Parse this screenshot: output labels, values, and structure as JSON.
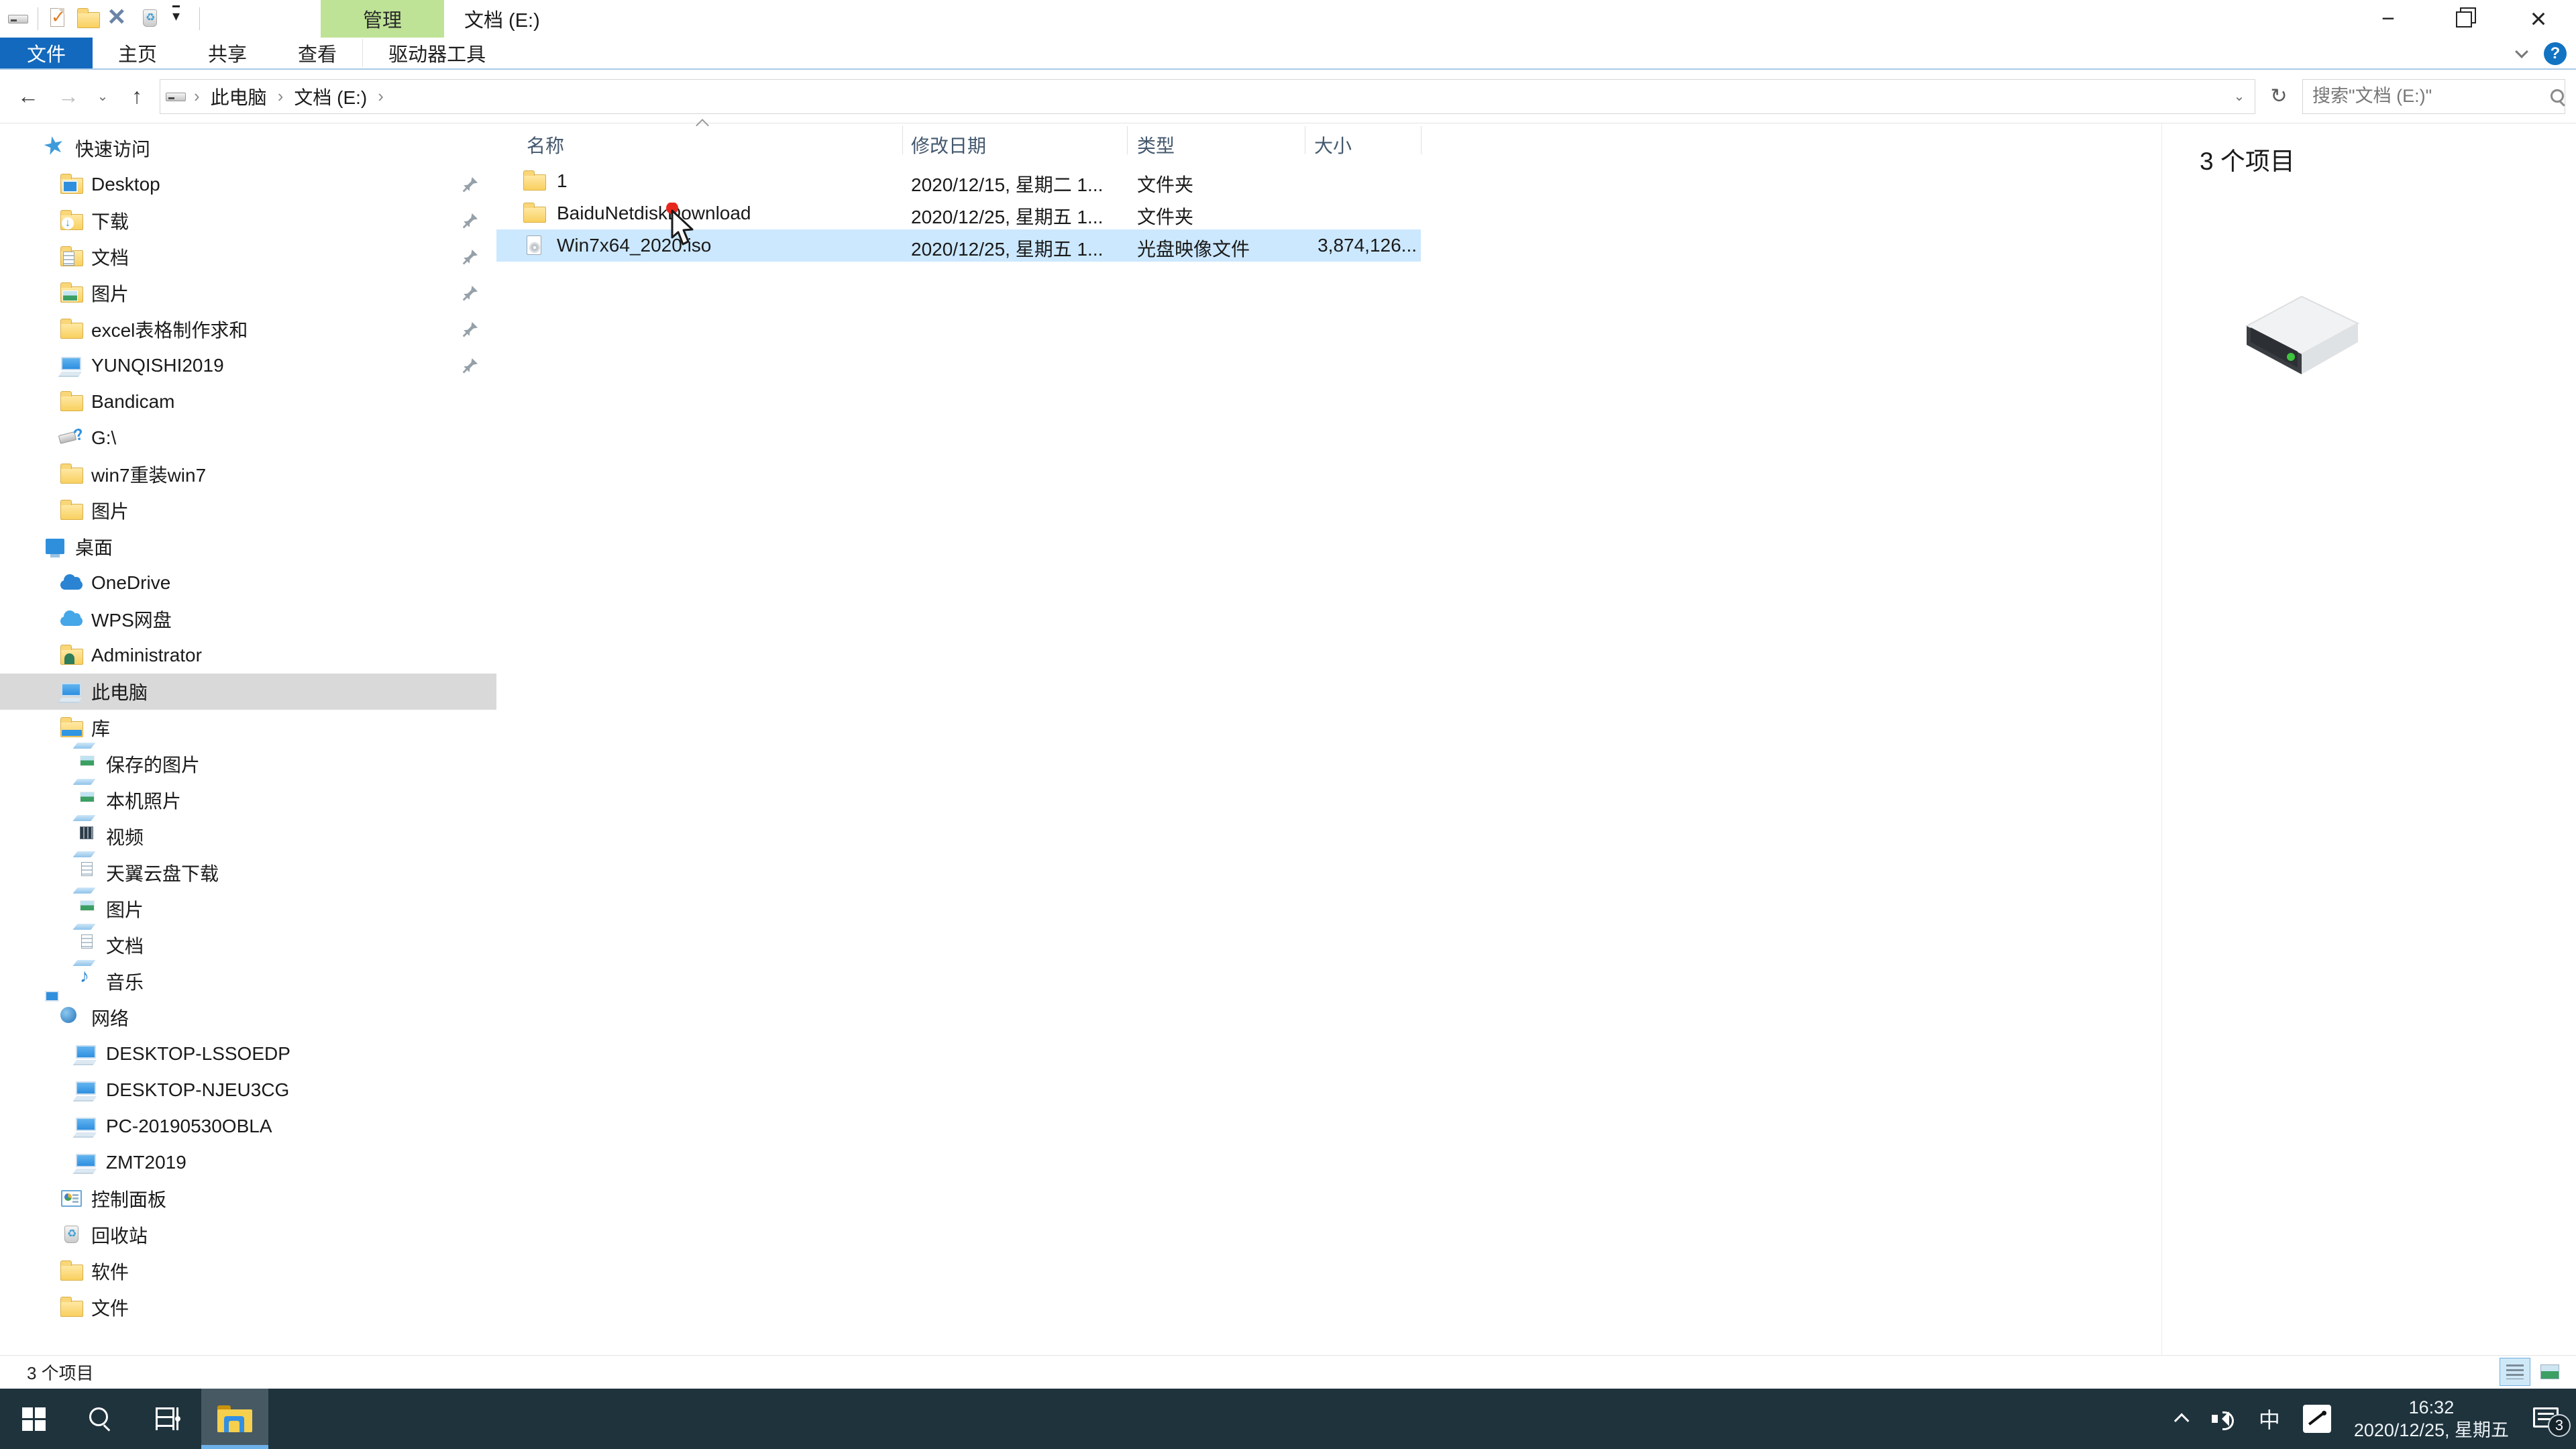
{
  "window": {
    "title": "文档 (E:)",
    "contextual_tab": "管理"
  },
  "ribbon": {
    "tabs": [
      {
        "label": "文件",
        "selected": true
      },
      {
        "label": "主页",
        "selected": false
      },
      {
        "label": "共享",
        "selected": false
      },
      {
        "label": "查看",
        "selected": false
      },
      {
        "label": "驱动器工具",
        "selected": false,
        "contextual": true
      }
    ]
  },
  "address": {
    "breadcrumb": [
      "此电脑",
      "文档 (E:)"
    ],
    "search_placeholder": "搜索\"文档 (E:)\""
  },
  "sidebar": {
    "items": [
      {
        "label": "快速访问",
        "icon": "star",
        "level": 0,
        "pinned": false,
        "selected": false
      },
      {
        "label": "Desktop",
        "icon": "folder-desktop",
        "level": 1,
        "pinned": true,
        "selected": false
      },
      {
        "label": "下载",
        "icon": "folder-download",
        "level": 1,
        "pinned": true,
        "selected": false
      },
      {
        "label": "文档",
        "icon": "folder-doc",
        "level": 1,
        "pinned": true,
        "selected": false
      },
      {
        "label": "图片",
        "icon": "folder-pic",
        "level": 1,
        "pinned": true,
        "selected": false
      },
      {
        "label": "excel表格制作求和",
        "icon": "folder",
        "level": 1,
        "pinned": true,
        "selected": false
      },
      {
        "label": "YUNQISHI2019",
        "icon": "pc",
        "level": 1,
        "pinned": true,
        "selected": false
      },
      {
        "label": "Bandicam",
        "icon": "folder",
        "level": 1,
        "pinned": false,
        "selected": false
      },
      {
        "label": "G:\\",
        "icon": "usb",
        "level": 1,
        "pinned": false,
        "selected": false
      },
      {
        "label": "win7重装win7",
        "icon": "folder",
        "level": 1,
        "pinned": false,
        "selected": false
      },
      {
        "label": "图片",
        "icon": "folder",
        "level": 1,
        "pinned": false,
        "selected": false
      },
      {
        "label": "桌面",
        "icon": "desktop",
        "level": 0,
        "pinned": false,
        "selected": false
      },
      {
        "label": "OneDrive",
        "icon": "cloud",
        "level": 1,
        "pinned": false,
        "selected": false
      },
      {
        "label": "WPS网盘",
        "icon": "cloud2",
        "level": 1,
        "pinned": false,
        "selected": false
      },
      {
        "label": "Administrator",
        "icon": "folder-user",
        "level": 1,
        "pinned": false,
        "selected": false
      },
      {
        "label": "此电脑",
        "icon": "pc",
        "level": 1,
        "pinned": false,
        "selected": true
      },
      {
        "label": "库",
        "icon": "library",
        "level": 1,
        "pinned": false,
        "selected": false
      },
      {
        "label": "保存的图片",
        "icon": "lib-pic",
        "level": 2,
        "pinned": false,
        "selected": false
      },
      {
        "label": "本机照片",
        "icon": "lib-pic",
        "level": 2,
        "pinned": false,
        "selected": false
      },
      {
        "label": "视频",
        "icon": "lib-video",
        "level": 2,
        "pinned": false,
        "selected": false
      },
      {
        "label": "天翼云盘下载",
        "icon": "lib-download",
        "level": 2,
        "pinned": false,
        "selected": false
      },
      {
        "label": "图片",
        "icon": "lib-pic",
        "level": 2,
        "pinned": false,
        "selected": false
      },
      {
        "label": "文档",
        "icon": "lib-doc",
        "level": 2,
        "pinned": false,
        "selected": false
      },
      {
        "label": "音乐",
        "icon": "lib-music",
        "level": 2,
        "pinned": false,
        "selected": false
      },
      {
        "label": "网络",
        "icon": "network",
        "level": 1,
        "pinned": false,
        "selected": false
      },
      {
        "label": "DESKTOP-LSSOEDP",
        "icon": "pc",
        "level": 2,
        "pinned": false,
        "selected": false
      },
      {
        "label": "DESKTOP-NJEU3CG",
        "icon": "pc",
        "level": 2,
        "pinned": false,
        "selected": false
      },
      {
        "label": "PC-20190530OBLA",
        "icon": "pc",
        "level": 2,
        "pinned": false,
        "selected": false
      },
      {
        "label": "ZMT2019",
        "icon": "pc",
        "level": 2,
        "pinned": false,
        "selected": false
      },
      {
        "label": "控制面板",
        "icon": "control",
        "level": 1,
        "pinned": false,
        "selected": false
      },
      {
        "label": "回收站",
        "icon": "recycle",
        "level": 1,
        "pinned": false,
        "selected": false
      },
      {
        "label": "软件",
        "icon": "folder",
        "level": 1,
        "pinned": false,
        "selected": false
      },
      {
        "label": "文件",
        "icon": "folder",
        "level": 1,
        "pinned": false,
        "selected": false
      }
    ]
  },
  "file_list": {
    "columns": [
      "名称",
      "修改日期",
      "类型",
      "大小"
    ],
    "rows": [
      {
        "name": "1",
        "icon": "folder",
        "date": "2020/12/15, 星期二 1...",
        "type": "文件夹",
        "size": "",
        "selected": false
      },
      {
        "name": "BaiduNetdiskDownload",
        "icon": "folder",
        "date": "2020/12/25, 星期五 1...",
        "type": "文件夹",
        "size": "",
        "selected": false
      },
      {
        "name": "Win7x64_2020.iso",
        "icon": "disc",
        "date": "2020/12/25, 星期五 1...",
        "type": "光盘映像文件",
        "size": "3,874,126...",
        "selected": true
      }
    ]
  },
  "details_pane": {
    "count_label": "3 个项目"
  },
  "status_bar": {
    "items_count": "3 个项目"
  },
  "taskbar": {
    "ime": "中",
    "time": "16:32",
    "date": "2020/12/25, 星期五",
    "notification_badge": "3"
  }
}
